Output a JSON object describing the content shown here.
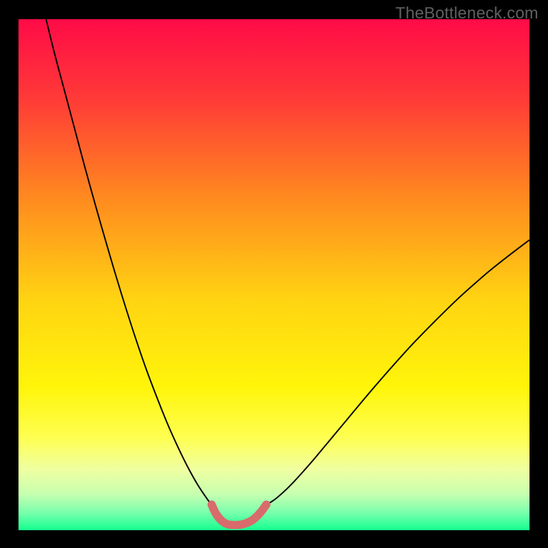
{
  "watermark": "TheBottleneck.com",
  "chart_data": {
    "type": "line",
    "title": "",
    "xlabel": "",
    "ylabel": "",
    "xlim": [
      0,
      100
    ],
    "ylim": [
      0,
      100
    ],
    "grid": false,
    "legend": false,
    "background_gradient": {
      "orientation": "vertical",
      "stops": [
        {
          "offset": 0.0,
          "color": "#ff0b47"
        },
        {
          "offset": 0.15,
          "color": "#ff3838"
        },
        {
          "offset": 0.35,
          "color": "#ff8a1f"
        },
        {
          "offset": 0.55,
          "color": "#ffd412"
        },
        {
          "offset": 0.72,
          "color": "#fff50a"
        },
        {
          "offset": 0.82,
          "color": "#feff52"
        },
        {
          "offset": 0.88,
          "color": "#f0ffa0"
        },
        {
          "offset": 0.93,
          "color": "#c6ffb0"
        },
        {
          "offset": 0.965,
          "color": "#7affad"
        },
        {
          "offset": 1.0,
          "color": "#14ff8f"
        }
      ]
    },
    "series": [
      {
        "name": "curve-left",
        "stroke": "#000000",
        "stroke_width": 2,
        "x": [
          5.4,
          7,
          9,
          11,
          13,
          15,
          17,
          19,
          21,
          23,
          25,
          27,
          29,
          31,
          33,
          35,
          37,
          37.8
        ],
        "y": [
          100,
          93.5,
          86,
          78.5,
          71,
          63.8,
          56.8,
          50,
          43.5,
          37.3,
          31.5,
          26.2,
          21.2,
          16.7,
          12.6,
          9.0,
          6.0,
          5.0
        ]
      },
      {
        "name": "curve-right",
        "stroke": "#000000",
        "stroke_width": 2,
        "x": [
          48.5,
          50,
          52,
          54,
          56,
          58,
          60,
          62,
          65,
          68,
          71,
          74,
          77,
          80,
          83,
          86,
          89,
          92,
          95,
          98,
          100
        ],
        "y": [
          5.0,
          5.9,
          7.6,
          9.6,
          11.8,
          14.1,
          16.5,
          18.9,
          22.5,
          26.1,
          29.6,
          33.0,
          36.3,
          39.4,
          42.4,
          45.3,
          48.0,
          50.6,
          53.0,
          55.3,
          56.8
        ]
      },
      {
        "name": "trough",
        "stroke": "#d86b6b",
        "stroke_width": 12,
        "linecap": "round",
        "x": [
          37.8,
          38.6,
          39.6,
          40.8,
          42.3,
          44.0,
          45.8,
          47.2,
          48.5
        ],
        "y": [
          5.0,
          3.3,
          2.0,
          1.2,
          1.0,
          1.2,
          2.0,
          3.3,
          5.0
        ]
      }
    ]
  }
}
